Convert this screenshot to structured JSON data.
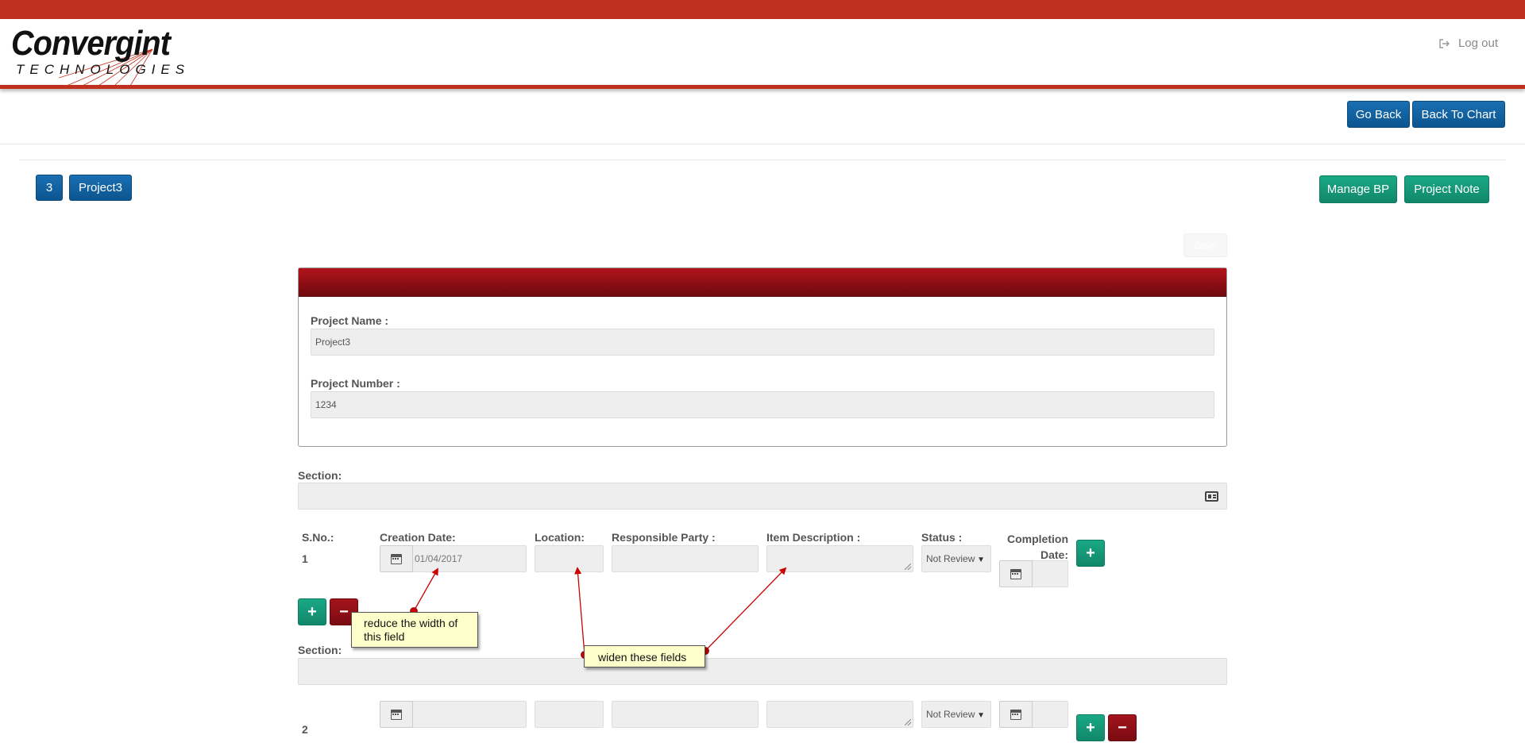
{
  "header": {
    "logo_main": "Convergint",
    "logo_sub": "TECHNOLOGIES",
    "logout_label": "Log out"
  },
  "toolbar": {
    "go_back_label": "Go Back",
    "back_to_chart_label": "Back To Chart"
  },
  "project_bar": {
    "id_badge": "3",
    "name_badge": "Project3",
    "manage_bp_label": "Manage BP",
    "project_note_label": "Project Note"
  },
  "form": {
    "save_label": "Save",
    "project_name_label": "Project Name :",
    "project_name_value": "Project3",
    "project_number_label": "Project Number :",
    "project_number_value": "1234",
    "section_label": "Section:"
  },
  "columns": {
    "sno": "S.No.:",
    "creation_date": "Creation Date:",
    "location": "Location:",
    "responsible_party": "Responsible Party :",
    "item_description": "Item Description :",
    "status": "Status :",
    "completion_date_line1": "Completion",
    "completion_date_line2": "Date:"
  },
  "rows": [
    {
      "sno": "1",
      "creation_date": "01/04/2017",
      "status": "Not Review"
    },
    {
      "sno": "2",
      "creation_date": "",
      "status": "Not Review"
    }
  ],
  "annotations": {
    "note1_line1": "reduce the width of",
    "note1_line2": "this field",
    "note2": "widen these fields",
    "arrow_color": "#cc0000"
  },
  "colors": {
    "brand_red": "#c0301f",
    "primary_blue": "#0f5f9f",
    "success_green": "#159b7a",
    "danger_red": "#8d0f16"
  }
}
